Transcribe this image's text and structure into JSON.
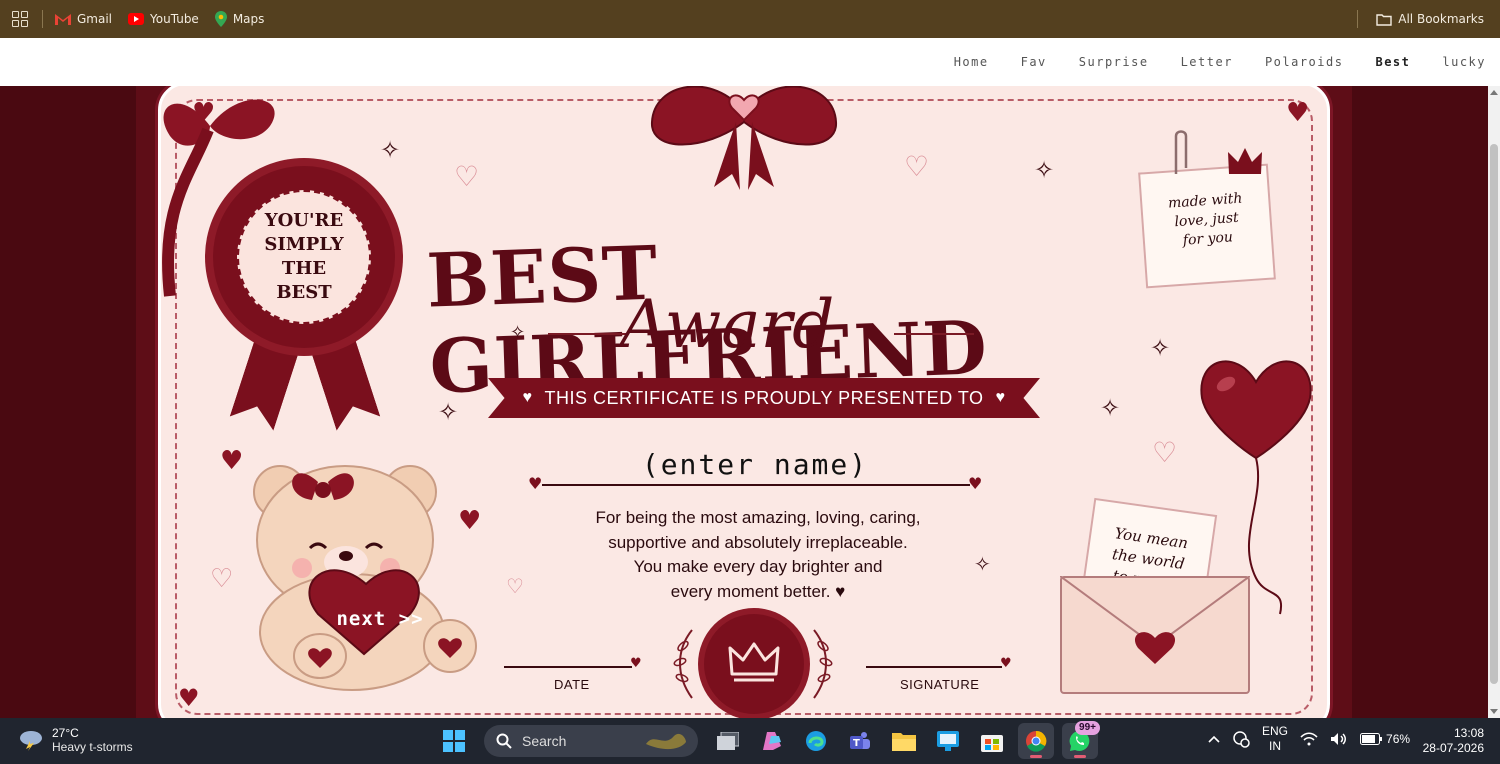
{
  "bookmarks": {
    "items": [
      {
        "label": "Gmail",
        "icon": "gmail-icon"
      },
      {
        "label": "YouTube",
        "icon": "youtube-icon"
      },
      {
        "label": "Maps",
        "icon": "maps-icon"
      }
    ],
    "all_bookmarks": "All Bookmarks"
  },
  "nav": {
    "items": [
      {
        "label": "Home"
      },
      {
        "label": "Fav"
      },
      {
        "label": "Surprise"
      },
      {
        "label": "Letter"
      },
      {
        "label": "Polaroids"
      },
      {
        "label": "Best",
        "active": true
      },
      {
        "label": "lucky"
      }
    ]
  },
  "certificate": {
    "title_line1": "BEST GIRLFRIEND",
    "title_line2": "Award",
    "banner": "THIS CERTIFICATE IS PROUDLY PRESENTED TO",
    "name_placeholder": "(enter name)",
    "message_lines": [
      "For being the most amazing, loving, caring,",
      "supportive and absolutely irreplaceable.",
      "You make every day brighter and",
      "every moment better. ♥"
    ],
    "date_label": "DATE",
    "signature_label": "SIGNATURE",
    "rosette_lines": [
      "YOU'RE",
      "SIMPLY",
      "THE",
      "BEST"
    ],
    "note_lines": [
      "made with",
      "love, just",
      "for you"
    ],
    "envelope_lines": [
      "You mean",
      "the world",
      "to me. ♡"
    ],
    "next_button": "next >>"
  },
  "taskbar": {
    "weather_temp": "27°C",
    "weather_condition": "Heavy t-storms",
    "search_label": "Search",
    "whatsapp_badge": "99+",
    "lang_line1": "ENG",
    "lang_line2": "IN",
    "battery": "76%",
    "time": "13:08",
    "date": "28-07-2026"
  },
  "colors": {
    "bookmark_bar": "#54401f",
    "accent_maroon": "#7a0f1d",
    "certificate_bg": "#fbe8e4",
    "page_bg": "#4a0911"
  }
}
